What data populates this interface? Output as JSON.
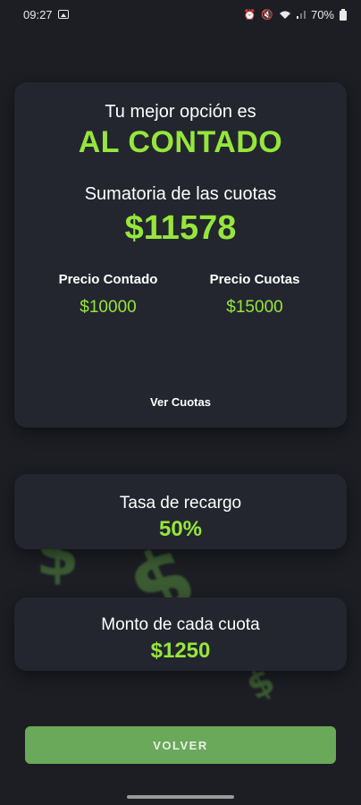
{
  "status_bar": {
    "time": "09:27",
    "battery": "70%",
    "icons": [
      "image-icon",
      "alarm-icon",
      "mute-icon",
      "wifi-icon",
      "signal-icon",
      "battery-icon"
    ]
  },
  "result_card": {
    "headline": "Tu mejor opción es",
    "best_option": "AL CONTADO",
    "sum_label": "Sumatoria de las cuotas",
    "sum_value": "$11578",
    "cash_price_label": "Precio Contado",
    "cash_price_value": "$10000",
    "installments_price_label": "Precio Cuotas",
    "installments_price_value": "$15000",
    "ver_cuotas_label": "Ver Cuotas"
  },
  "surcharge_card": {
    "label": "Tasa de recargo",
    "value": "50%"
  },
  "installment_card": {
    "label": "Monto de cada cuota",
    "value": "$1250"
  },
  "volver_label": "VOLVER",
  "colors": {
    "background": "#1c1e24",
    "card": "#23262e",
    "accent_green": "#96e63c",
    "button_green": "#6aa85a"
  }
}
